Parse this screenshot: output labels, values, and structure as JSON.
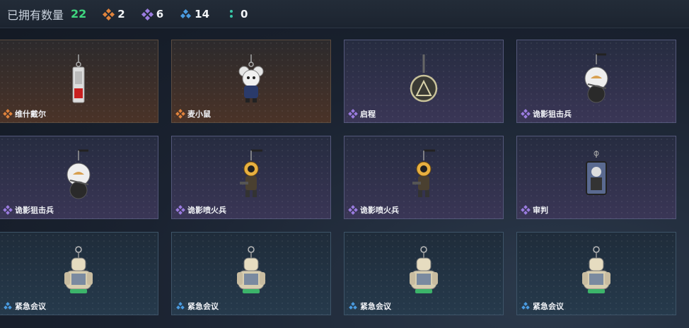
{
  "header": {
    "owned_label": "已拥有数量",
    "owned_count": "22",
    "stats": [
      {
        "icon": "orange-diamond-icon",
        "value": "2",
        "color": "#e0833c"
      },
      {
        "icon": "purple-diamond-icon",
        "value": "6",
        "color": "#9b7ce0"
      },
      {
        "icon": "blue-diamond-icon",
        "value": "14",
        "color": "#4a9be0"
      },
      {
        "icon": "green-dots-icon",
        "value": "0",
        "color": "#39c7a8"
      }
    ]
  },
  "items": [
    {
      "name": "维什戴尔",
      "rarity": "orange",
      "icon": "vial-keychain-icon"
    },
    {
      "name": "麦小鼠",
      "rarity": "orange",
      "icon": "mouse-keychain-icon"
    },
    {
      "name": "启程",
      "rarity": "purple",
      "icon": "medallion-keychain-icon"
    },
    {
      "name": "诡影狙击兵",
      "rarity": "purple",
      "icon": "sniper-keychain-icon"
    },
    {
      "name": "诡影狙击兵",
      "rarity": "purple",
      "icon": "sniper-keychain-icon"
    },
    {
      "name": "诡影喷火兵",
      "rarity": "purple",
      "icon": "flamer-keychain-icon"
    },
    {
      "name": "诡影喷火兵",
      "rarity": "purple",
      "icon": "flamer-keychain-icon"
    },
    {
      "name": "审判",
      "rarity": "purple",
      "icon": "card-keychain-icon"
    },
    {
      "name": "紧急会议",
      "rarity": "blue",
      "icon": "robot-keychain-icon"
    },
    {
      "name": "紧急会议",
      "rarity": "blue",
      "icon": "robot-keychain-icon"
    },
    {
      "name": "紧急会议",
      "rarity": "blue",
      "icon": "robot-keychain-icon"
    },
    {
      "name": "紧急会议",
      "rarity": "blue",
      "icon": "robot-keychain-icon"
    }
  ],
  "colors": {
    "orange": "#e0833c",
    "purple": "#9b7ce0",
    "blue": "#4a9be0",
    "accent_green": "#3fd67f"
  }
}
